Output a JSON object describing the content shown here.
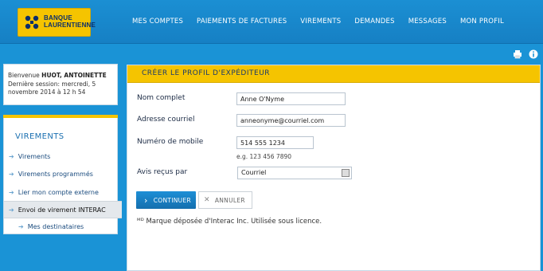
{
  "brand": {
    "line1": "BANQUE",
    "line2": "LAURENTIENNE"
  },
  "nav": [
    "MES COMPTES",
    "PAIEMENTS DE FACTURES",
    "VIREMENTS",
    "DEMANDES",
    "MESSAGES",
    "MON PROFIL"
  ],
  "welcome": {
    "prefix": "Bienvenue",
    "name": "HUOT, ANTOINETTE",
    "last_session": "Dernière session: mercredi, 5 novembre 2014 à 12 h 54"
  },
  "sidebar": {
    "title": "VIREMENTS",
    "items": [
      {
        "label": "Virements"
      },
      {
        "label": "Virements programmés"
      },
      {
        "label": "Lier mon compte externe"
      },
      {
        "label": "Envoi de virement INTERAC"
      },
      {
        "label": "Mes destinataires"
      }
    ]
  },
  "form": {
    "title": "CRÉER LE PROFIL D'EXPÉDITEUR",
    "fields": {
      "full_name": {
        "label": "Nom complet",
        "value": "Anne O'Nyme"
      },
      "email": {
        "label": "Adresse courriel",
        "value": "anneonyme@courriel.com"
      },
      "mobile": {
        "label": "Numéro de mobile",
        "value": "514 555 1234",
        "hint": "e.g. 123 456 7890"
      },
      "notify": {
        "label": "Avis reçus par",
        "value": "Courriel"
      }
    },
    "buttons": {
      "continue": "CONTINUER",
      "cancel": "ANNULER"
    },
    "trademark": "ᴹᴰ Marque déposée d'Interac Inc. Utilisée sous licence."
  },
  "colors": {
    "brand_yellow": "#f5c400",
    "nav_blue": "#1a93d6",
    "primary_button": "#1d8fd6"
  },
  "icons": [
    "print-icon",
    "info-icon",
    "chevron-right-icon",
    "close-icon",
    "dropdown-arrow-icon"
  ]
}
